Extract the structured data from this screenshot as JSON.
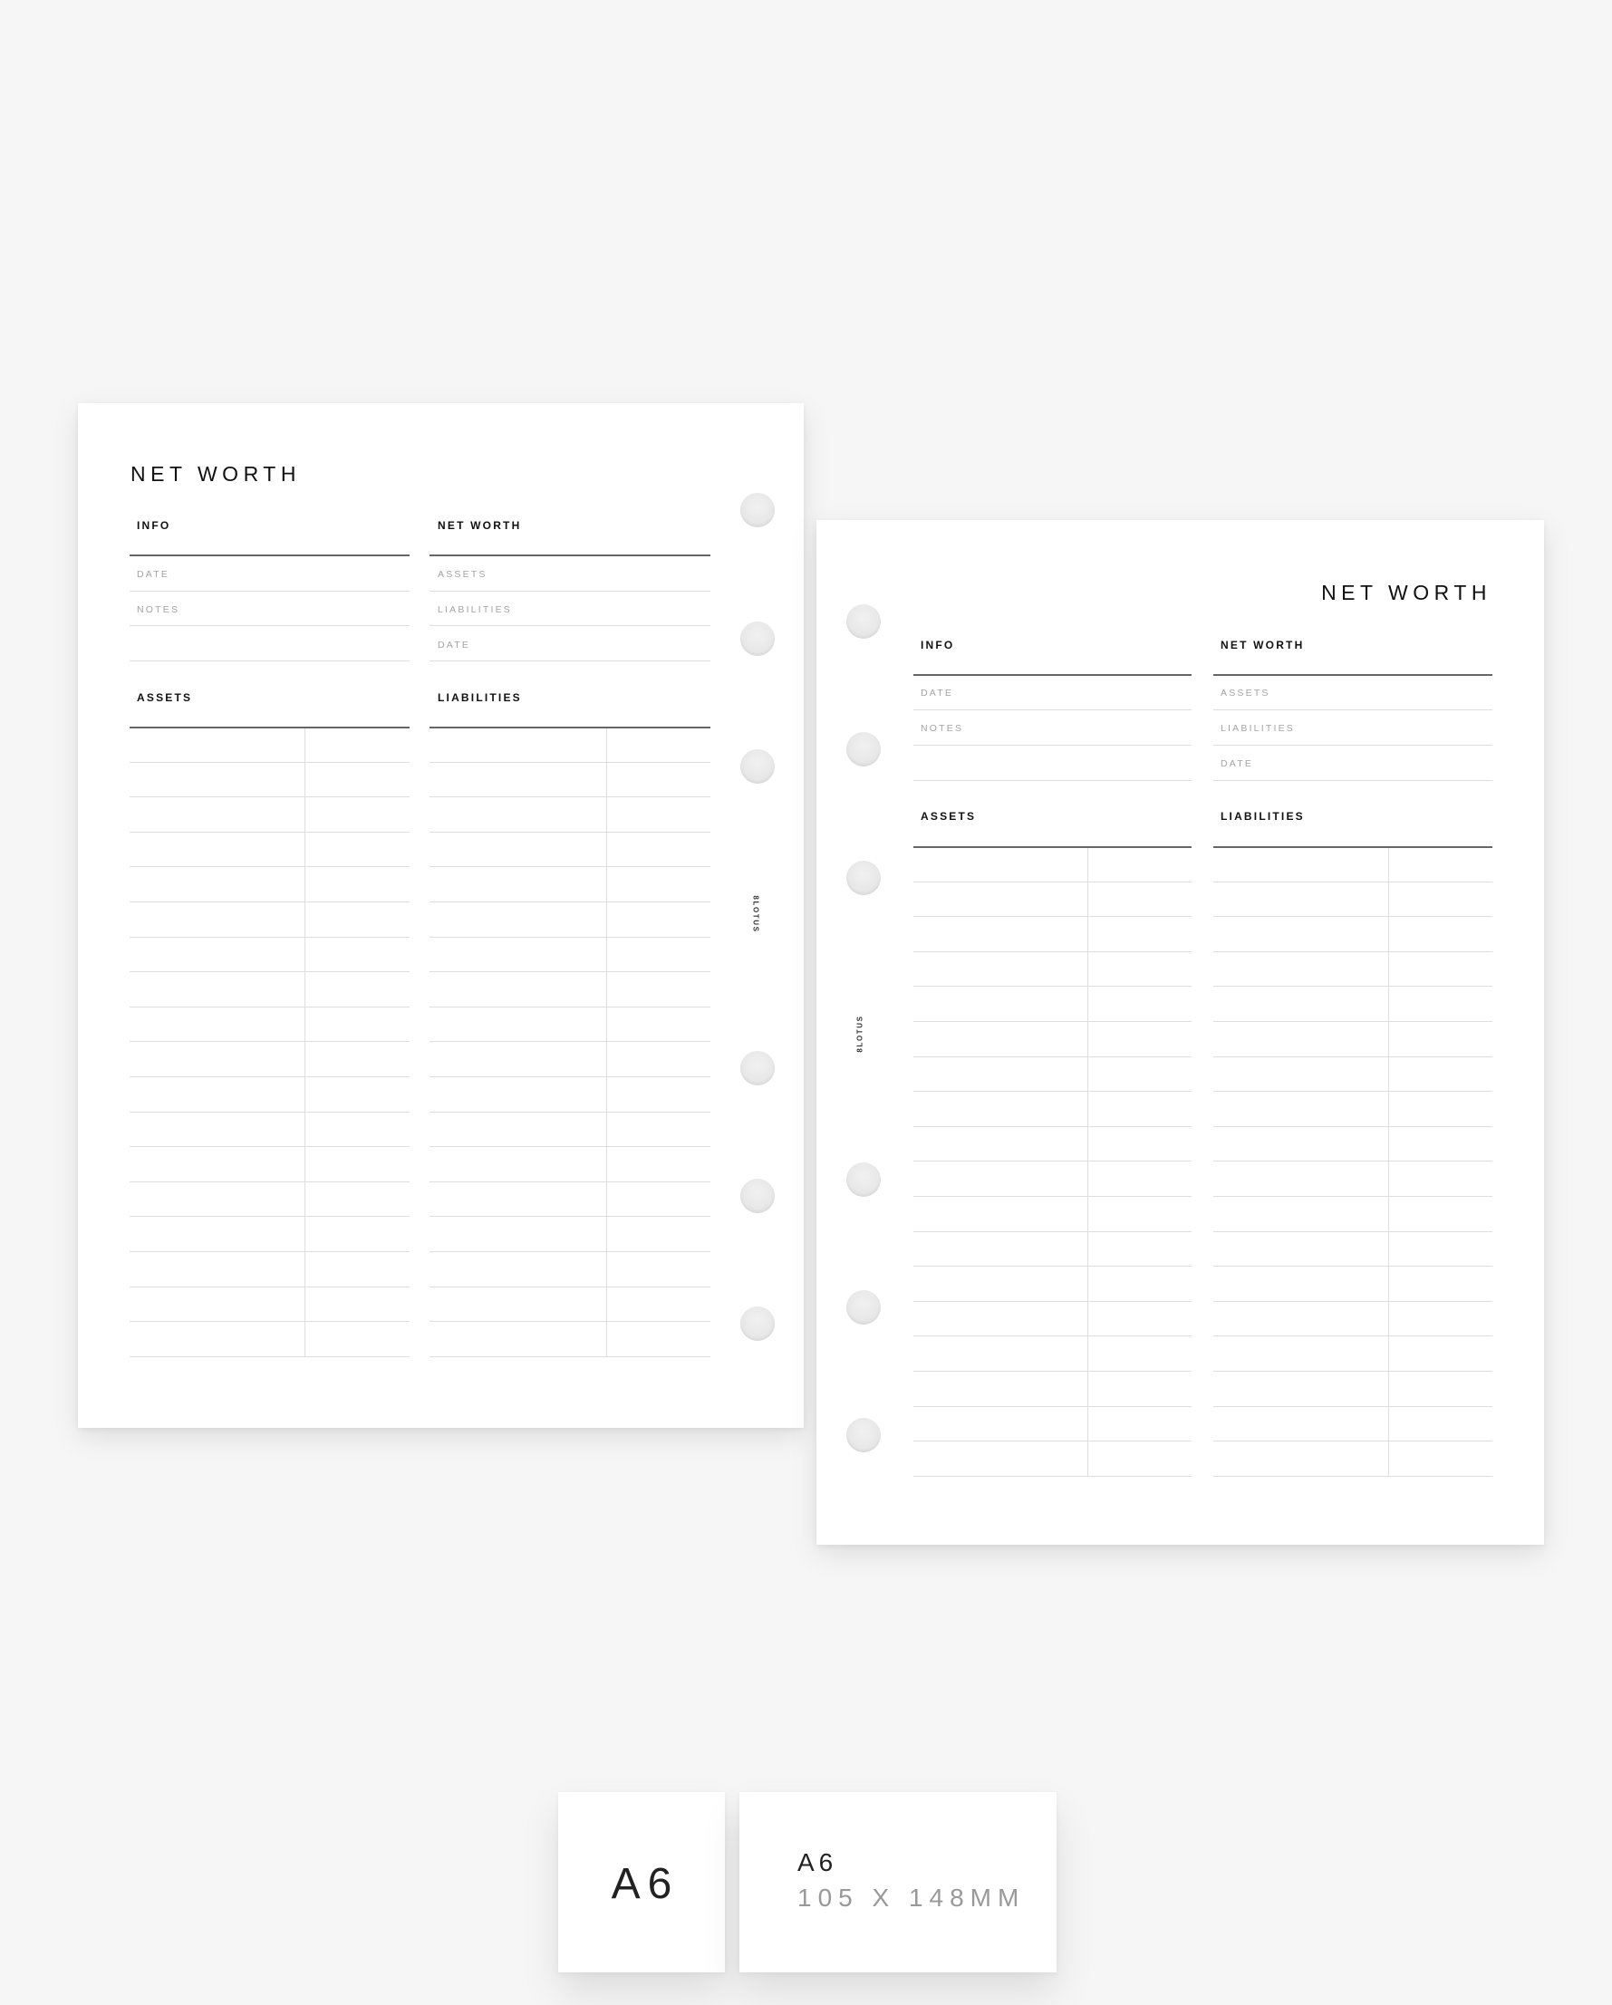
{
  "pages": [
    {
      "id": "left",
      "orientation": "left-page",
      "title": "NET WORTH",
      "info": {
        "heading": "INFO",
        "fields": [
          "DATE",
          "NOTES",
          ""
        ]
      },
      "net_worth": {
        "heading": "NET WORTH",
        "fields": [
          "ASSETS",
          "LIABILITIES",
          "DATE"
        ]
      },
      "assets": {
        "heading": "ASSETS",
        "rows": 18,
        "columns": 2
      },
      "liabilities": {
        "heading": "LIABILITIES",
        "rows": 18,
        "columns": 2
      },
      "brand": "8LOTUS",
      "holes": 6
    },
    {
      "id": "right",
      "orientation": "right-page",
      "title": "NET WORTH",
      "info": {
        "heading": "INFO",
        "fields": [
          "DATE",
          "NOTES",
          ""
        ]
      },
      "net_worth": {
        "heading": "NET WORTH",
        "fields": [
          "ASSETS",
          "LIABILITIES",
          "DATE"
        ]
      },
      "assets": {
        "heading": "ASSETS",
        "rows": 18,
        "columns": 2
      },
      "liabilities": {
        "heading": "LIABILITIES",
        "rows": 18,
        "columns": 2
      },
      "brand": "8LOTUS",
      "holes": 6
    }
  ],
  "size_cards": {
    "size_label": "A6",
    "detail_label": "A6",
    "dimensions": "105 X 148MM"
  },
  "colors": {
    "background": "#f6f6f6",
    "paper": "#ffffff",
    "heading_text": "#111111",
    "field_label_text": "#a3a3a3",
    "dark_rule": "#666666",
    "light_rule": "#dedede",
    "dimension_text": "#999999"
  }
}
